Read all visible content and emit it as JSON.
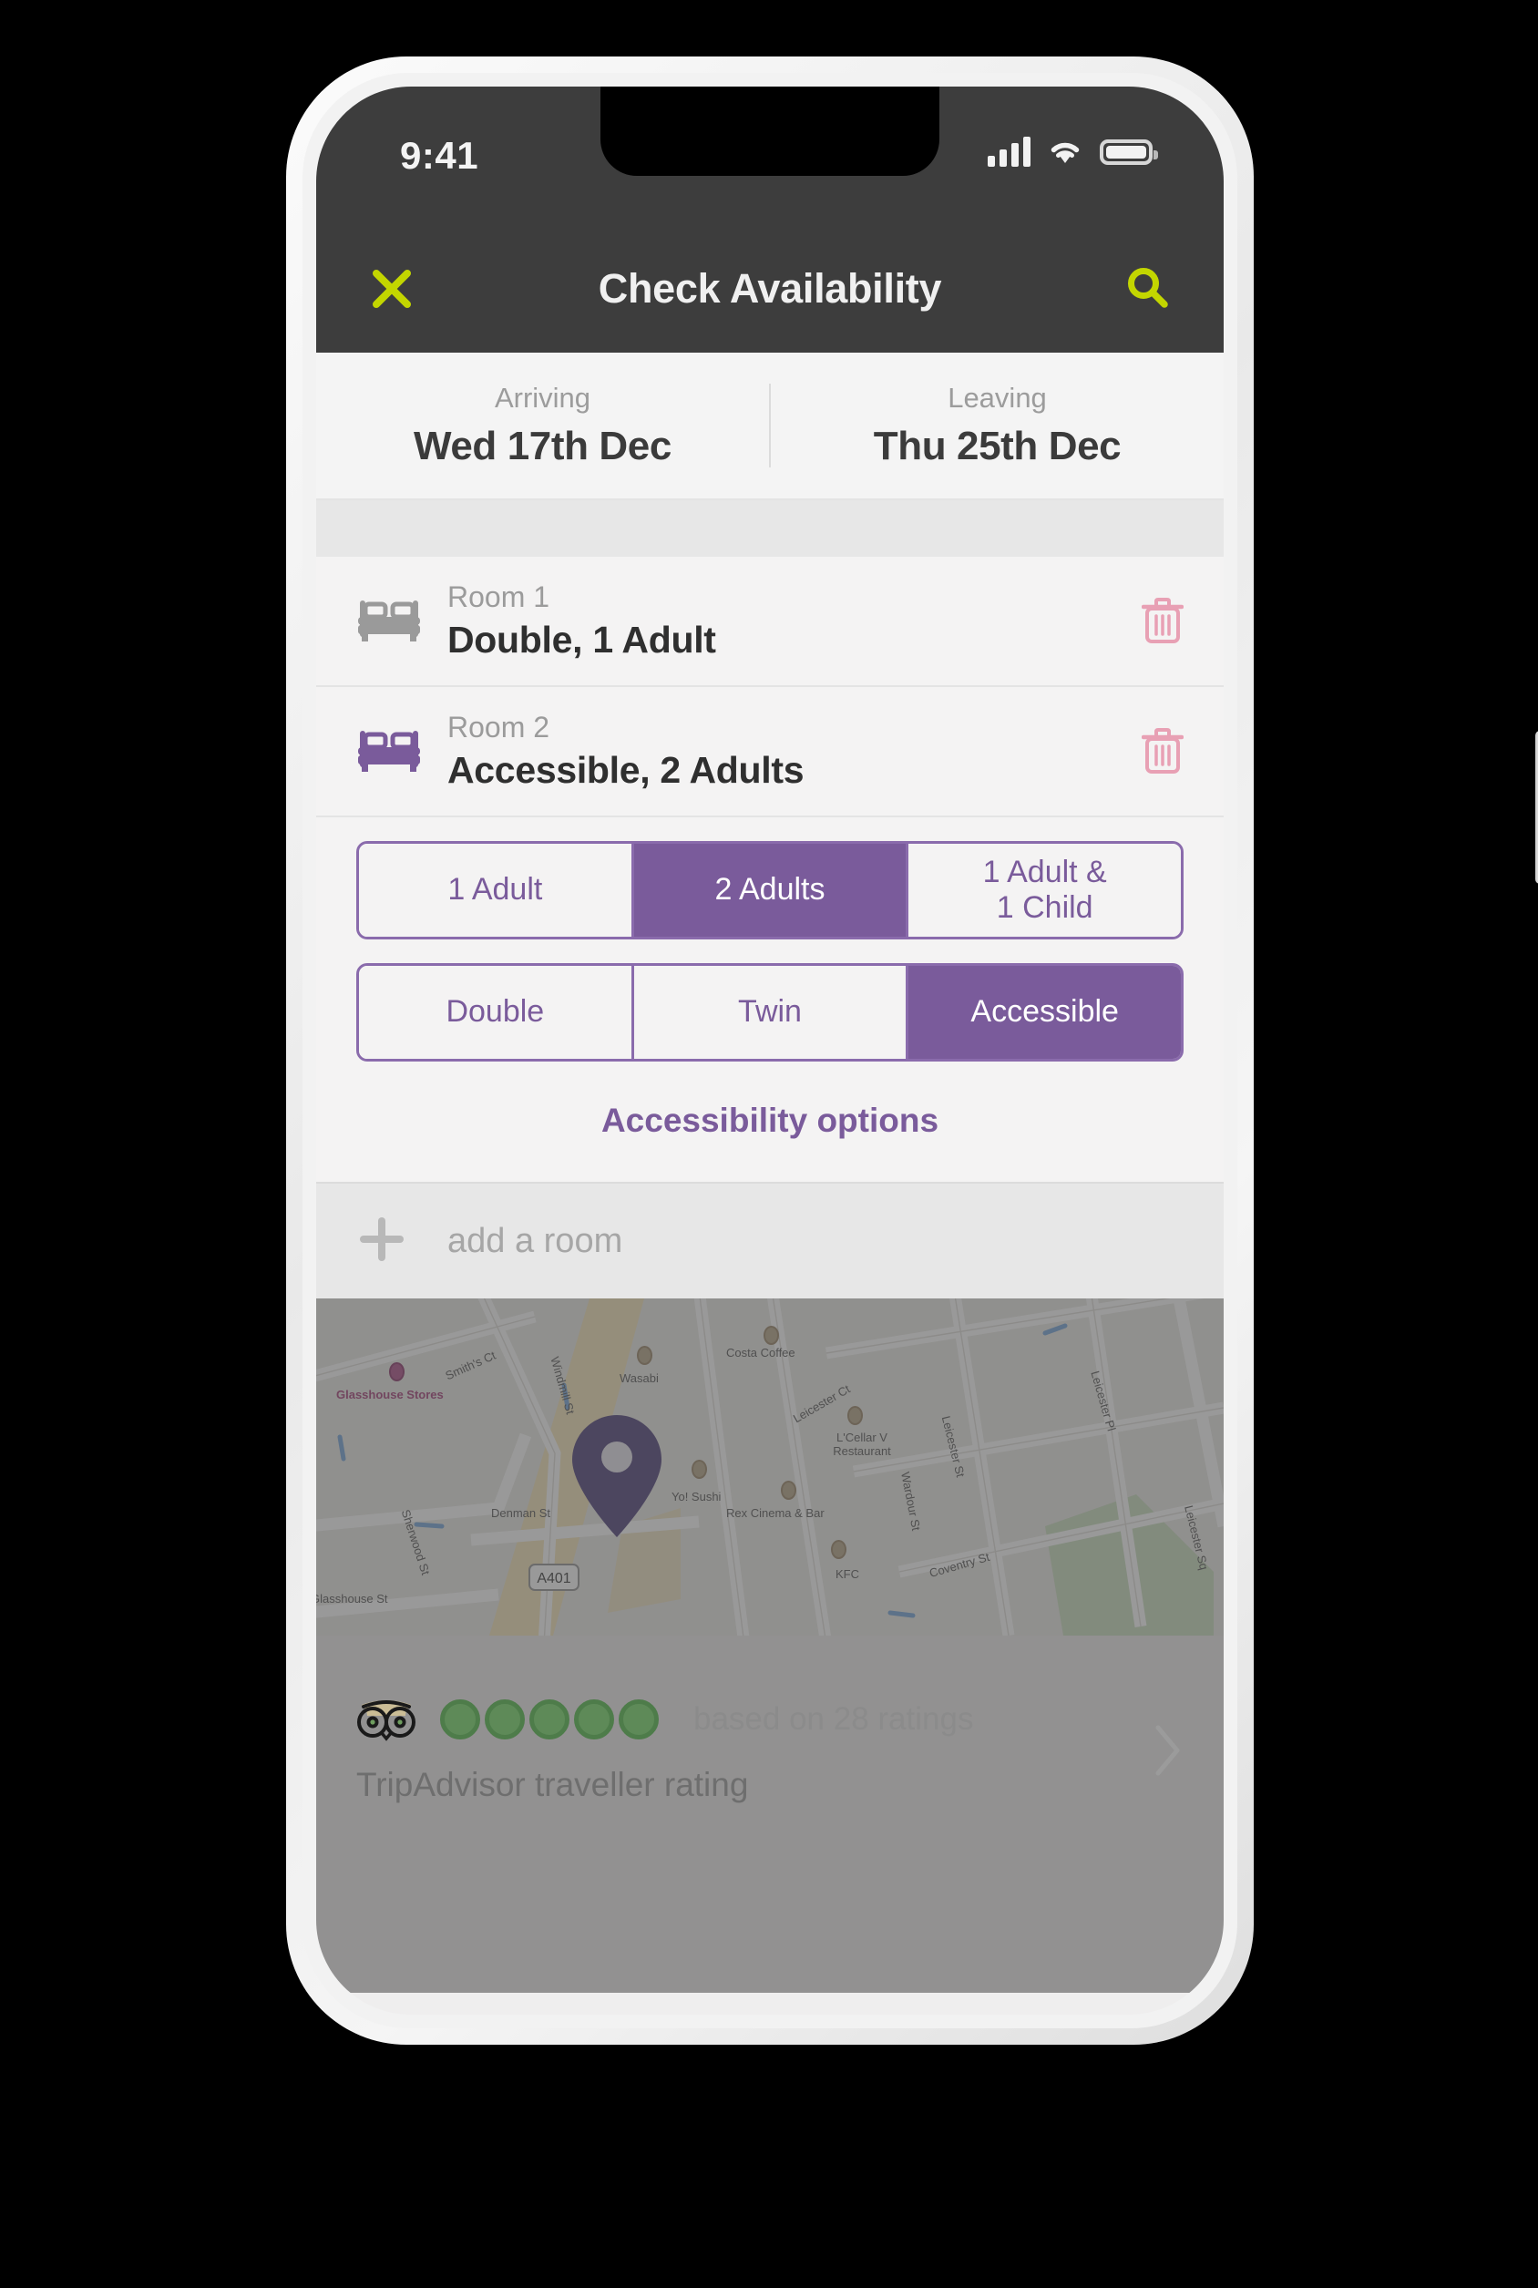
{
  "status_bar": {
    "time": "9:41",
    "signal_icon": "signal-bars-icon",
    "wifi_icon": "wifi-icon",
    "battery_icon": "battery-full-icon"
  },
  "header": {
    "title": "Check Availability",
    "close_icon": "close-x-icon",
    "search_icon": "search-icon",
    "background": "#3d3d3d",
    "accent": "#c3d600"
  },
  "dates": {
    "arriving": {
      "label": "Arriving",
      "value": "Wed 17th Dec"
    },
    "leaving": {
      "label": "Leaving",
      "value": "Thu 25th Dec"
    }
  },
  "rooms": [
    {
      "label": "Room 1",
      "value": "Double, 1 Adult",
      "bed_icon": "bed-icon",
      "bed_color": "#9a9a9a",
      "delete_icon": "trash-icon"
    },
    {
      "label": "Room 2",
      "value": "Accessible, 2 Adults",
      "bed_icon": "bed-icon",
      "bed_color": "#7a5b9b",
      "delete_icon": "trash-icon"
    }
  ],
  "occupancy_options": [
    {
      "label": "1 Adult",
      "selected": false
    },
    {
      "label": "2 Adults",
      "selected": true
    },
    {
      "label": "1 Adult &\n1 Child",
      "selected": false
    }
  ],
  "room_type_options": [
    {
      "label": "Double",
      "selected": false
    },
    {
      "label": "Twin",
      "selected": false
    },
    {
      "label": "Accessible",
      "selected": true
    }
  ],
  "accessibility_link": "Accessibility options",
  "add_room": {
    "label": "add a room",
    "icon": "plus-icon"
  },
  "map": {
    "pin_icon": "map-pin-icon",
    "pin_color": "#56477e",
    "road_badge": "A401",
    "labels": [
      "Glasshouse Stores",
      "Smith's Ct",
      "Windmill St",
      "Wasabi",
      "Costa Coffee",
      "L'Cellar V Restaurant",
      "Leicester Ct",
      "Yo! Sushi",
      "Denman St",
      "Rex Cinema & Bar",
      "Wardour St",
      "Leicester St",
      "KFC",
      "Coventry St",
      "Sherwood St",
      "Glasshouse St",
      "Leicester Sq",
      "Leicester Pl"
    ]
  },
  "tripadvisor": {
    "logo_icon": "tripadvisor-owl-icon",
    "rating_bubbles": 5,
    "rating_filled": 5,
    "count_text": "based on 28 ratings",
    "caption": "TripAdvisor traveller rating",
    "chevron_icon": "chevron-right-icon",
    "bubble_color": "#5e8a58"
  },
  "theme": {
    "purple": "#7a5b9b",
    "purple_border": "#8a6bac",
    "lime": "#c3d600",
    "dark": "#3d3d3d",
    "pink": "#e8a0b4",
    "gray_text": "#9b9b9b"
  }
}
